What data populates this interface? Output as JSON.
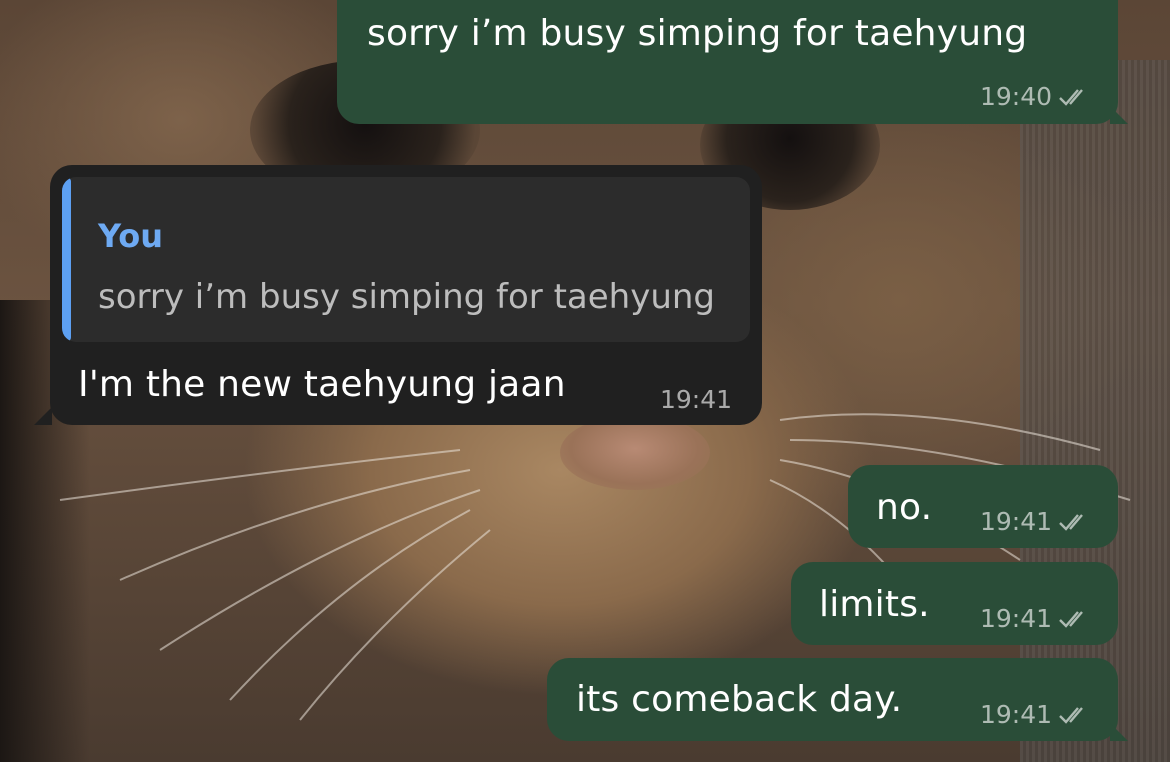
{
  "wallpaper": {
    "description_icon": "cat-photo-wallpaper"
  },
  "colors": {
    "outgoing_bubble": "#2a4d38",
    "incoming_bubble": "#202020",
    "reply_accent": "#5da0f2",
    "meta_text": "#9fb2a6"
  },
  "messages": [
    {
      "direction": "out",
      "text": "sorry i’m busy simping for taehyung",
      "time": "19:40",
      "status_icon": "double-check-icon"
    },
    {
      "direction": "in",
      "reply": {
        "name": "You",
        "text": "sorry i’m busy simping for taehyung"
      },
      "text": "I'm the new taehyung jaan",
      "time": "19:41"
    },
    {
      "direction": "out",
      "text": "no.",
      "time": "19:41",
      "status_icon": "double-check-icon"
    },
    {
      "direction": "out",
      "text": "limits.",
      "time": "19:41",
      "status_icon": "double-check-icon"
    },
    {
      "direction": "out",
      "text": "its comeback day.",
      "time": "19:41",
      "status_icon": "double-check-icon"
    }
  ]
}
